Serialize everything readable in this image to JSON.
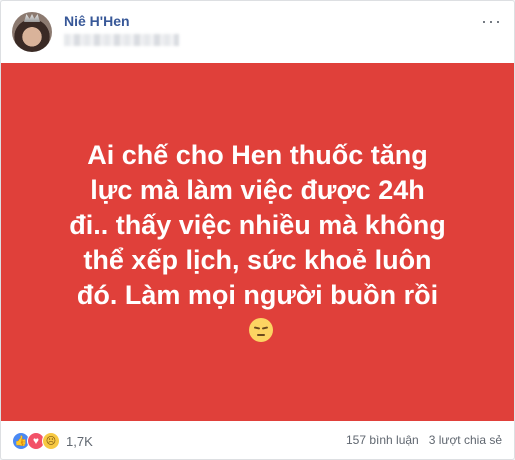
{
  "post": {
    "author_name": "Niê H'Hen",
    "status_text": "Ai chế cho Hen thuốc tăng lực mà làm việc được 24h đi.. thấy việc nhiều mà không thể xếp lịch, sức khoẻ luôn đó. Làm mọi người buồn rồi",
    "more_button": "···",
    "background_color": "#e0403a"
  },
  "footer": {
    "reaction_count": "1,7K",
    "comments": "157 bình luận",
    "shares": "3 lượt chia sẻ"
  },
  "icons": {
    "reaction_like": "like-icon",
    "reaction_love": "love-icon",
    "reaction_sad": "sad-icon",
    "status_emoji": "pensive-face-emoji"
  }
}
